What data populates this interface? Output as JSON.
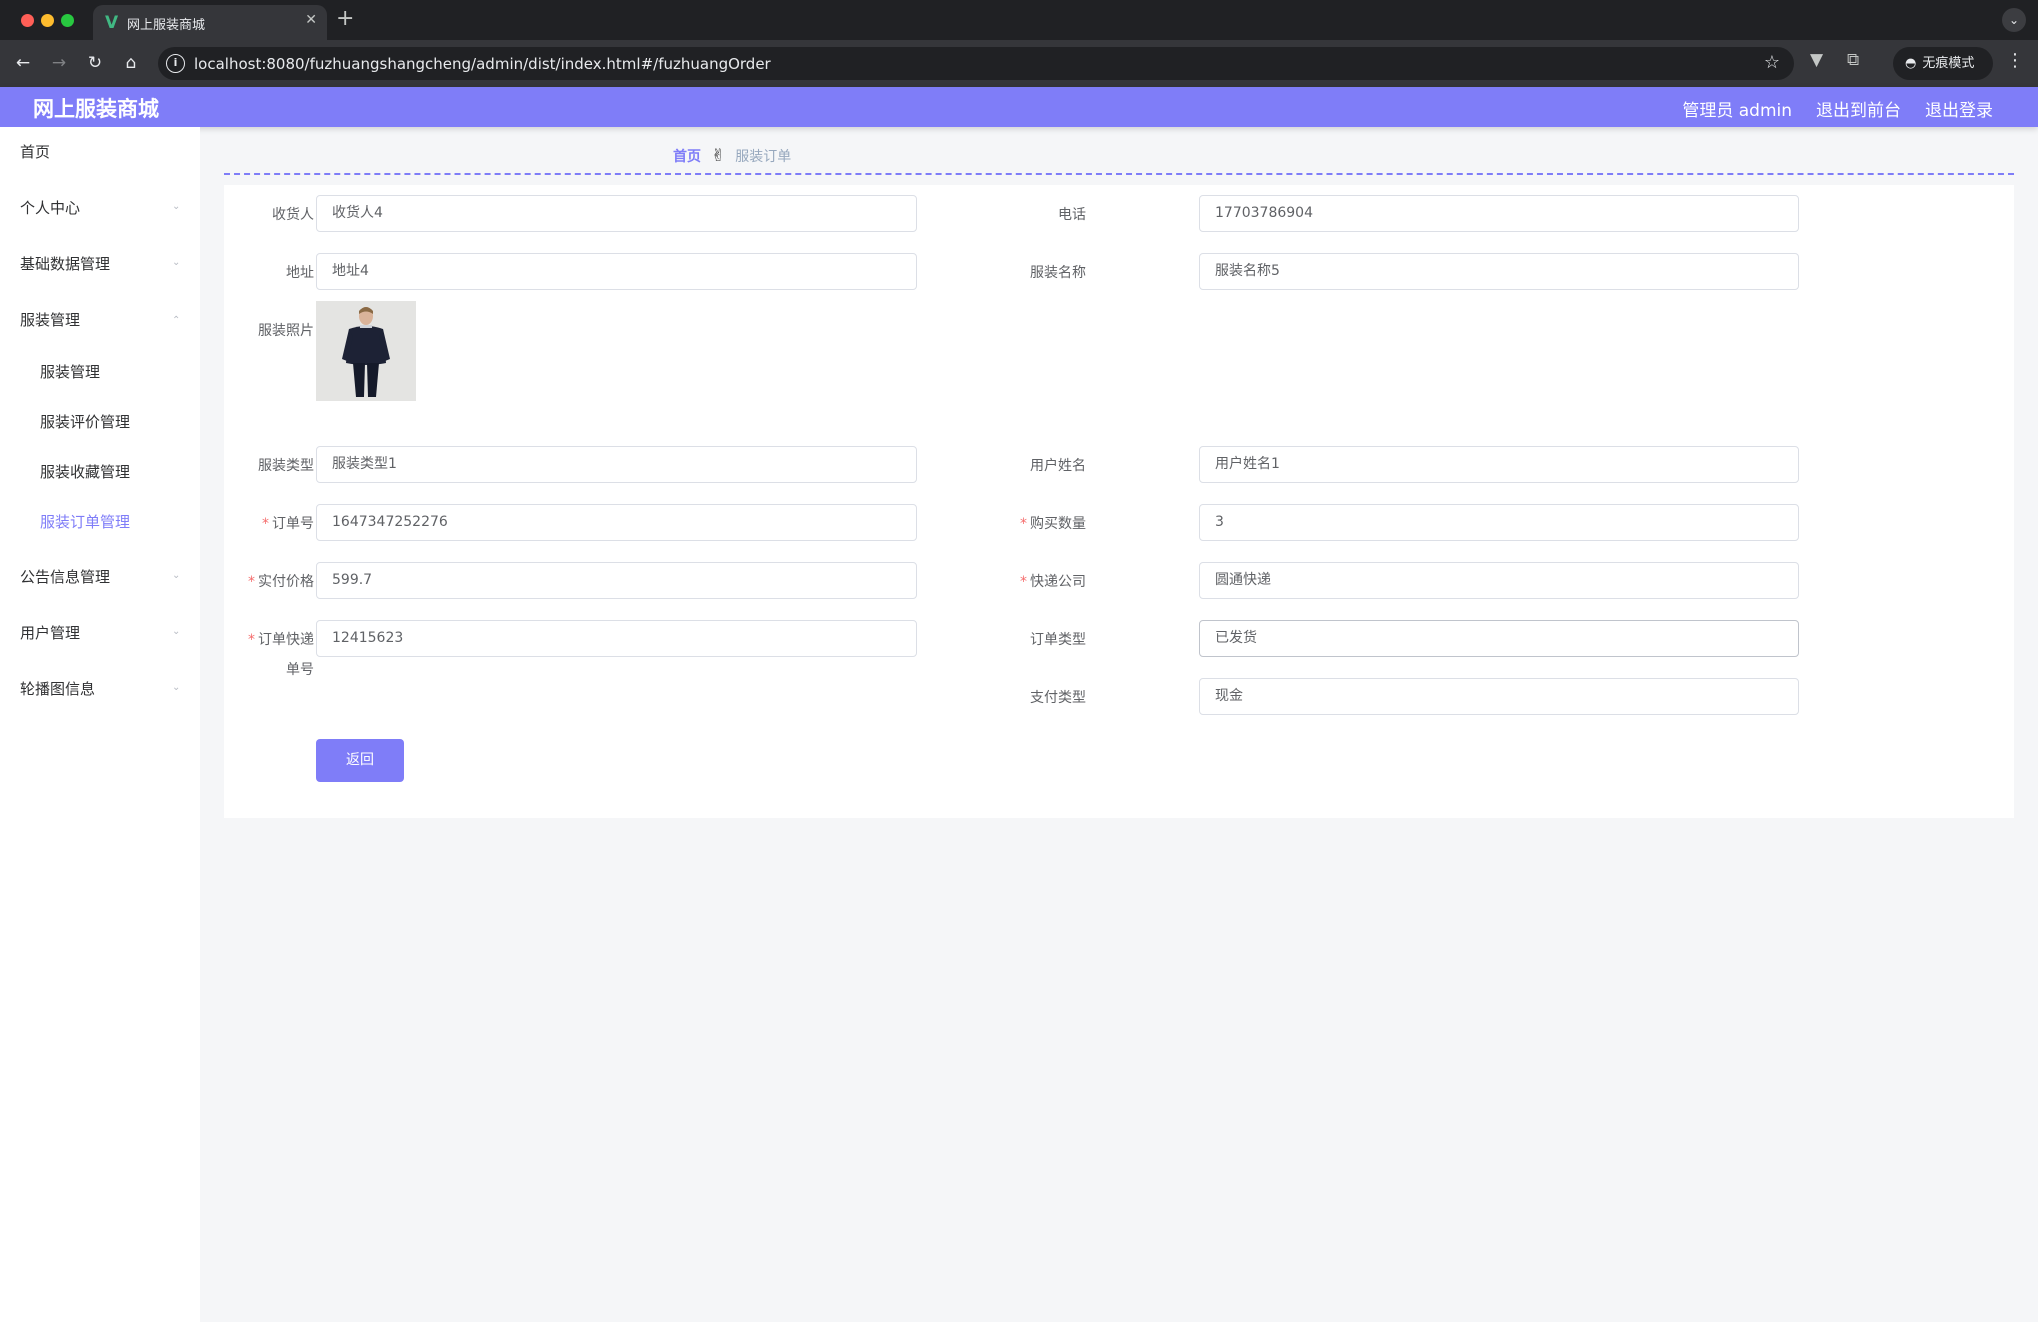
{
  "browser": {
    "tab_title": "网上服装商城",
    "tab_favicon": "V",
    "url": "localhost:8080/fuzhuangshangcheng/admin/dist/index.html#/fuzhuangOrder",
    "incognito_label": "无痕模式"
  },
  "header": {
    "brand": "网上服装商城",
    "admin_label": "管理员 admin",
    "frontend_link": "退出到前台",
    "logout_link": "退出登录"
  },
  "sidebar": {
    "items": [
      {
        "label": "首页"
      },
      {
        "label": "个人中心"
      },
      {
        "label": "基础数据管理"
      },
      {
        "label": "服装管理"
      },
      {
        "label": "公告信息管理"
      },
      {
        "label": "用户管理"
      },
      {
        "label": "轮播图信息"
      }
    ],
    "submenu": [
      {
        "label": "服装管理"
      },
      {
        "label": "服装评价管理"
      },
      {
        "label": "服装收藏管理"
      },
      {
        "label": "服装订单管理"
      }
    ],
    "active_color": "#7f7df8"
  },
  "breadcrumb": {
    "home": "首页",
    "separator": "✌",
    "current": "服装订单"
  },
  "form": {
    "receiver": {
      "label": "收货人",
      "value": "收货人4"
    },
    "phone": {
      "label": "电话",
      "value": "17703786904"
    },
    "address": {
      "label": "地址",
      "value": "地址4"
    },
    "clothing_name": {
      "label": "服装名称",
      "value": "服装名称5"
    },
    "clothing_photo": {
      "label": "服装照片"
    },
    "clothing_type": {
      "label": "服装类型",
      "value": "服装类型1"
    },
    "user_name": {
      "label": "用户姓名",
      "value": "用户姓名1"
    },
    "order_no": {
      "label": "订单号",
      "value": "1647347252276",
      "required": "*"
    },
    "quantity": {
      "label": "购买数量",
      "value": "3",
      "required": "*"
    },
    "actual_price": {
      "label": "实付价格",
      "value": "599.7",
      "required": "*"
    },
    "courier": {
      "label": "快递公司",
      "value": "圆通快递",
      "required": "*"
    },
    "tracking_no": {
      "label_line1": "订单快递",
      "label_line2": "单号",
      "value": "12415623",
      "required": "*"
    },
    "order_type": {
      "label": "订单类型",
      "value": "已发货"
    },
    "payment_type": {
      "label": "支付类型",
      "value": "现金"
    },
    "back_button": "返回"
  },
  "theme": {
    "accent": "#7f7df8",
    "required_color": "#f56c6c"
  }
}
